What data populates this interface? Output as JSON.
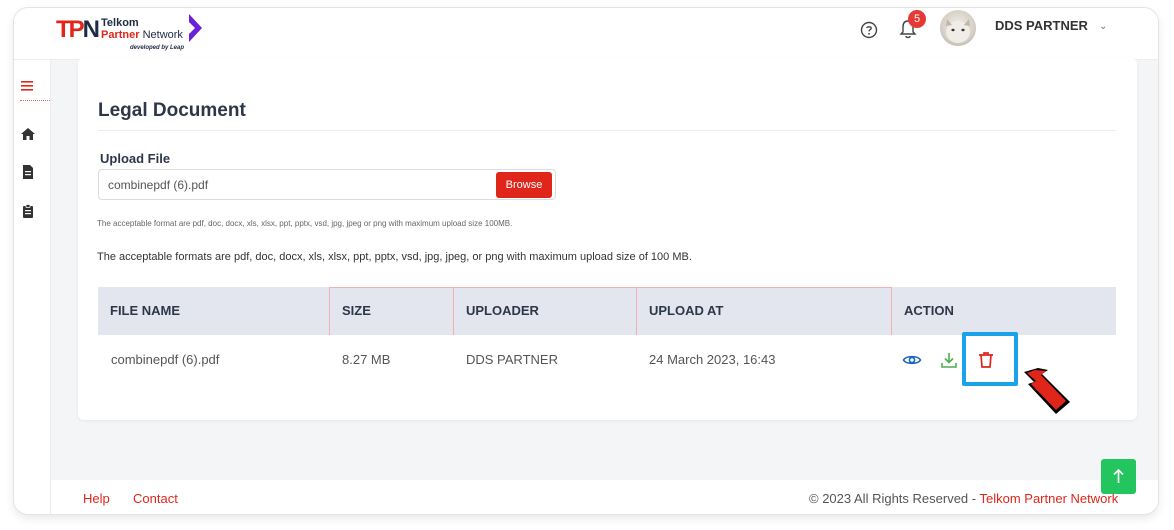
{
  "header": {
    "logo_mark": "TPN",
    "logo_line1": "Telkom",
    "logo_line2_a": "Partner",
    "logo_line2_b": " Network",
    "logo_sub": "developed by Leap",
    "notification_count": "5",
    "user_name": "DDS PARTNER",
    "icons": [
      "help-icon",
      "bell-icon",
      "avatar",
      "chevron-down-icon"
    ]
  },
  "sidebar": {
    "icons": [
      "menu-icon",
      "home-icon",
      "document-icon",
      "clipboard-icon"
    ]
  },
  "page": {
    "title": "Legal Document",
    "upload_label": "Upload File",
    "upload_value": "combinepdf (6).pdf",
    "browse_label": "Browse",
    "hint_small": "The acceptable format are pdf, doc, docx, xls, xlsx, ppt, pptx, vsd, jpg, jpeg or png with maximum upload size 100MB.",
    "hint_big": "The acceptable formats are pdf, doc, docx, xls, xlsx, ppt, pptx, vsd, jpg, jpeg, or png with maximum upload size of 100 MB."
  },
  "table": {
    "headers": [
      "FILE NAME",
      "SIZE",
      "UPLOADER",
      "UPLOAD AT",
      "ACTION"
    ],
    "rows": [
      {
        "file_name": "combinepdf (6).pdf",
        "size": "8.27 MB",
        "uploader": "DDS PARTNER",
        "upload_at": "24 March 2023, 16:43",
        "actions": [
          "eye-icon",
          "download-icon",
          "trash-icon"
        ]
      }
    ]
  },
  "footer": {
    "help": "Help",
    "contact": "Contact",
    "copyright_prefix": "© 2023  All Rights Reserved - ",
    "copyright_brand": "Telkom Partner Network"
  },
  "colors": {
    "brand_red": "#e0261b",
    "highlight_blue": "#1aa3e8",
    "download_green": "#4caf50",
    "eye_blue": "#1565c0",
    "scroll_top_green": "#22c55e"
  }
}
